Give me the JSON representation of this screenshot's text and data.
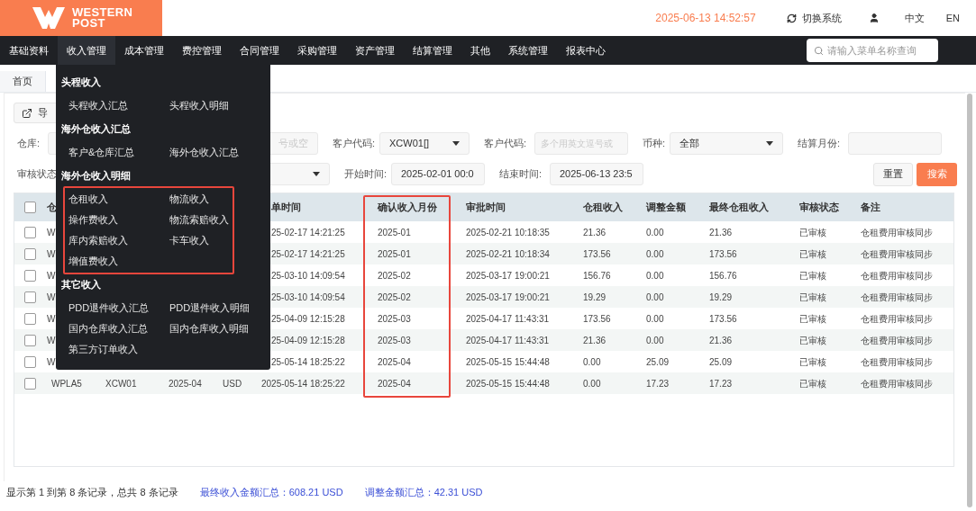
{
  "header": {
    "logo": {
      "line_1": "WESTERN",
      "line_2": "POST"
    },
    "datetime": "2025-06-13 14:52:57",
    "switch_system": "切换系统",
    "languages": [
      "中文",
      "EN"
    ]
  },
  "nav": {
    "items": [
      {
        "label": "基础资料",
        "selected": false
      },
      {
        "label": "收入管理",
        "selected": true
      },
      {
        "label": "成本管理",
        "selected": false
      },
      {
        "label": "费控管理",
        "selected": false
      },
      {
        "label": "合同管理",
        "selected": false
      },
      {
        "label": "采购管理",
        "selected": false
      },
      {
        "label": "资产管理",
        "selected": false
      },
      {
        "label": "结算管理",
        "selected": false
      },
      {
        "label": "其他",
        "selected": false
      },
      {
        "label": "系统管理",
        "selected": false
      },
      {
        "label": "报表中心",
        "selected": false
      }
    ],
    "search": {
      "placeholder": "请输入菜单名称查询"
    }
  },
  "menu": {
    "sections": [
      {
        "title": "头程收入",
        "highlighted": false,
        "items": [
          "头程收入汇总",
          "头程收入明细"
        ]
      },
      {
        "title": "海外仓收入汇总",
        "highlighted": false,
        "items": [
          "客户&仓库汇总",
          "海外仓收入汇总"
        ]
      },
      {
        "title": "海外仓收入明细",
        "highlighted": true,
        "items": [
          "仓租收入",
          "物流收入",
          "操作费收入",
          "物流索赔收入",
          "库内索赔收入",
          "卡车收入",
          "增值费收入"
        ]
      },
      {
        "title": "其它收入",
        "highlighted": false,
        "items": [
          "PDD退件收入汇总",
          "PDD退件收入明细",
          "国内仓库收入汇总",
          "国内仓库收入明细",
          "第三方订单收入"
        ]
      }
    ]
  },
  "tabs": [
    {
      "label": "首页",
      "selected": true
    }
  ],
  "toolbar": {
    "export_button": "导"
  },
  "filters": {
    "warehouse_label": "仓库:",
    "warehouse_placeholder": "号或空",
    "customer_code_label": "客户代码:",
    "customer_code_value": "XCW01[]",
    "customer_code_2_label": "客户代码:",
    "customer_code_2_placeholder": "多个用英文逗号或",
    "currency_label": "币种:",
    "currency_value": "全部",
    "settlement_month_label": "结算月份:",
    "audit_status_label": "审核状态",
    "start_time_label": "开始时间:",
    "start_time_value": "2025-02-01 00:0",
    "end_time_label": "结束时间:",
    "end_time_value": "2025-06-13 23:5",
    "reset_button": "重置",
    "search_button": "搜索"
  },
  "table": {
    "header_checkbox": {
      "checked": false
    },
    "columns": [
      {
        "kind": "text",
        "label": "仓"
      },
      {
        "kind": "hidden"
      },
      {
        "kind": "hidden"
      },
      {
        "kind": "hidden"
      },
      {
        "kind": "text",
        "label": "单时间"
      },
      {
        "kind": "text",
        "label": "确认收入月份",
        "highlighted": true
      },
      {
        "kind": "text",
        "label": "审批时间"
      },
      {
        "kind": "text",
        "label": "仓租收入"
      },
      {
        "kind": "text",
        "label": "调整金额"
      },
      {
        "kind": "text",
        "label": "最终仓租收入"
      },
      {
        "kind": "text",
        "label": "审核状态"
      },
      {
        "kind": "text",
        "label": "备注"
      }
    ],
    "rows": [
      {
        "checked": false,
        "cells": [
          "W",
          null,
          null,
          null,
          "25-02-17 14:21:25",
          "2025-01",
          "2025-02-21 10:18:35",
          "21.36",
          "0.00",
          "21.36",
          "已审核",
          "仓租费用审核同步"
        ]
      },
      {
        "checked": false,
        "cells": [
          "W",
          null,
          null,
          null,
          "25-02-17 14:21:25",
          "2025-01",
          "2025-02-21 10:18:34",
          "173.56",
          "0.00",
          "173.56",
          "已审核",
          "仓租费用审核同步"
        ]
      },
      {
        "checked": false,
        "cells": [
          "W",
          null,
          null,
          null,
          "25-03-10 14:09:54",
          "2025-02",
          "2025-03-17 19:00:21",
          "156.76",
          "0.00",
          "156.76",
          "已审核",
          "仓租费用审核同步"
        ]
      },
      {
        "checked": false,
        "cells": [
          "W",
          null,
          null,
          null,
          "25-03-10 14:09:54",
          "2025-02",
          "2025-03-17 19:00:21",
          "19.29",
          "0.00",
          "19.29",
          "已审核",
          "仓租费用审核同步"
        ]
      },
      {
        "checked": false,
        "cells": [
          "W",
          null,
          null,
          null,
          "25-04-09 12:15:28",
          "2025-03",
          "2025-04-17 11:43:31",
          "173.56",
          "0.00",
          "173.56",
          "已审核",
          "仓租费用审核同步"
        ]
      },
      {
        "checked": false,
        "cells": [
          "W",
          null,
          null,
          null,
          "25-04-09 12:15:28",
          "2025-03",
          "2025-04-17 11:43:31",
          "21.36",
          "0.00",
          "21.36",
          "已审核",
          "仓租费用审核同步"
        ]
      },
      {
        "checked": false,
        "cells": [
          "W",
          null,
          null,
          null,
          "25-05-14 18:25:22",
          "2025-04",
          "2025-05-15 15:44:48",
          "0.00",
          "25.09",
          "25.09",
          "已审核",
          "仓租费用审核同步"
        ]
      },
      {
        "checked": false,
        "cells": [
          "WPLA5",
          "XCW01",
          "2025-04",
          "USD",
          "2025-05-14 18:25:22",
          "2025-04",
          "2025-05-15 15:44:48",
          "0.00",
          "17.23",
          "17.23",
          "已审核",
          "仓租费用审核同步"
        ]
      }
    ]
  },
  "footer": {
    "records": "显示第 1 到第 8 条记录，总共 8 条记录",
    "final_total": "最终收入金额汇总：608.21 USD",
    "adjust_total": "调整金额汇总：42.31 USD"
  }
}
